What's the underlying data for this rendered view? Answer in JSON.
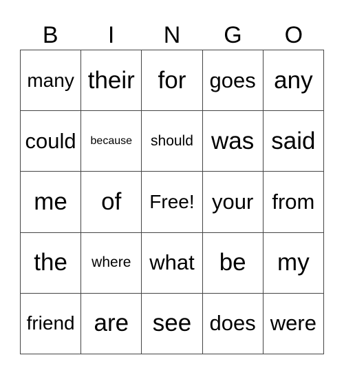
{
  "header": [
    "B",
    "I",
    "N",
    "G",
    "O"
  ],
  "rows": [
    [
      "many",
      "their",
      "for",
      "goes",
      "any"
    ],
    [
      "could",
      "because",
      "should",
      "was",
      "said"
    ],
    [
      "me",
      "of",
      "Free!",
      "your",
      "from"
    ],
    [
      "the",
      "where",
      "what",
      "be",
      "my"
    ],
    [
      "friend",
      "are",
      "see",
      "does",
      "were"
    ]
  ]
}
